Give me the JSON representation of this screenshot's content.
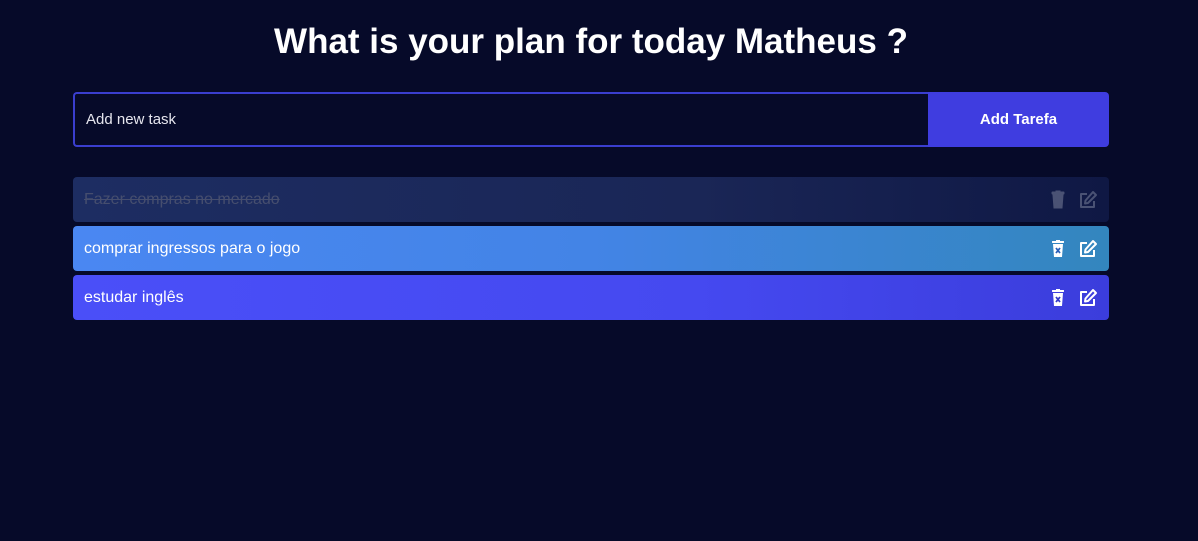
{
  "header": {
    "title": "What is your plan for today Matheus ?"
  },
  "form": {
    "input_placeholder": "Add new task",
    "input_value": "",
    "add_button_label": "Add Tarefa"
  },
  "tasks": [
    {
      "text": "Fazer compras no mercado",
      "completed": true
    },
    {
      "text": "comprar ingressos para o jogo",
      "completed": false
    },
    {
      "text": "estudar inglês",
      "completed": false
    }
  ],
  "icons": {
    "delete": "trash-icon",
    "edit": "edit-icon"
  },
  "colors": {
    "background": "#060a29",
    "accent": "#3f3de0",
    "task_blue": "#4384e6",
    "task_indigo": "#4549f0",
    "task_completed": "#1a2656"
  }
}
